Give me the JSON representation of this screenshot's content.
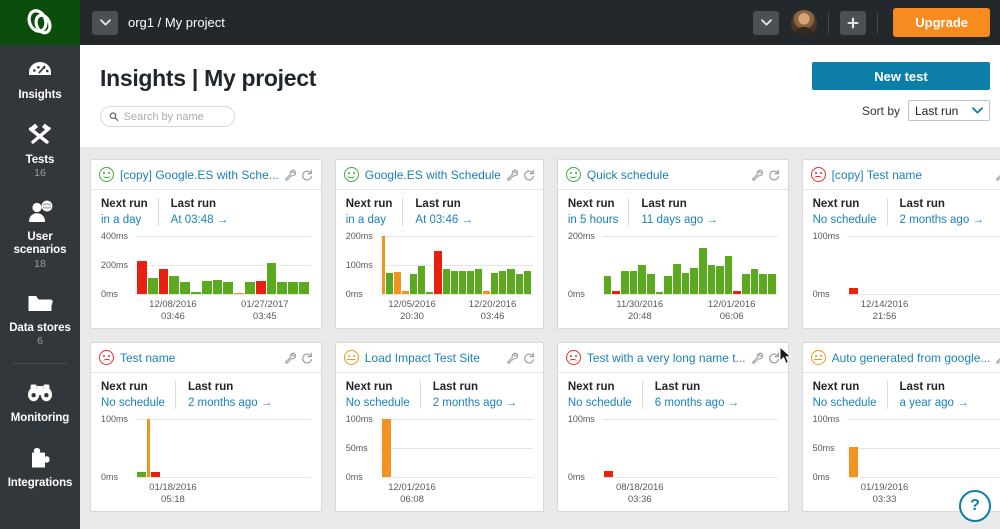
{
  "topbar": {
    "project_toggle_icon": "chevron-down-icon",
    "breadcrumb": "org1 / My project",
    "user_menu_icon": "chevron-down-icon",
    "add_icon": "plus-icon",
    "upgrade_label": "Upgrade"
  },
  "sidebar": {
    "logo": "loadimpact-logo",
    "items": [
      {
        "label": "Insights",
        "count": "",
        "icon": "gauge-icon",
        "active": true
      },
      {
        "label": "Tests",
        "count": "16",
        "icon": "hammers-icon",
        "active": false
      },
      {
        "label": "User scenarios",
        "count": "18",
        "icon": "user-globe-icon",
        "active": false
      },
      {
        "label": "Data stores",
        "count": "6",
        "icon": "folder-icon",
        "active": false
      },
      {
        "label": "Monitoring",
        "count": "",
        "icon": "binoculars-icon",
        "active": false
      },
      {
        "label": "Integrations",
        "count": "",
        "icon": "puzzle-icon",
        "active": false
      }
    ]
  },
  "page": {
    "title": "Insights | My project",
    "new_test_label": "New test",
    "search_placeholder": "Search by name",
    "search_value": "",
    "search_icon": "search-icon",
    "sort_label": "Sort by",
    "sort_value": "Last run",
    "sort_icon": "chevron-down-icon",
    "help_label": "?"
  },
  "labels": {
    "next_run": "Next run",
    "last_run": "Last run",
    "settings_icon": "wrench-icon",
    "refresh_icon": "refresh-icon"
  },
  "colors": {
    "green": "#5aa91e",
    "red": "#e8200f",
    "orange": "#f0941f",
    "accent": "#0d7ea8",
    "link": "#1a82b8",
    "upgrade": "#f68b1f",
    "sidebar": "#32373c",
    "topbar": "#23282d",
    "logo_bg": "#0b4d0b"
  },
  "cards": [
    {
      "status": "green",
      "title": "[copy] Google.ES with Sche...",
      "next_run": "in a day",
      "last_run": "At 03:48 →",
      "chart_data": {
        "type": "bar",
        "ylabel": "ms",
        "yticks": [
          "400ms",
          "200ms",
          "0ms"
        ],
        "ylim": [
          0,
          400
        ],
        "x_start": "12/08/2016 03:46",
        "x_end": "01/27/2017 03:45",
        "bars": [
          {
            "value": 230,
            "color": "red"
          },
          {
            "value": 110,
            "color": "green"
          },
          {
            "value": 175,
            "color": "red"
          },
          {
            "value": 125,
            "color": "green"
          },
          {
            "value": 85,
            "color": "green"
          },
          {
            "value": 12,
            "color": "green"
          },
          {
            "value": 90,
            "color": "green"
          },
          {
            "value": 95,
            "color": "green"
          },
          {
            "value": 85,
            "color": "green"
          },
          {
            "value": 10,
            "color": "orange"
          },
          {
            "value": 80,
            "color": "green"
          },
          {
            "value": 88,
            "color": "red"
          },
          {
            "value": 215,
            "color": "green"
          },
          {
            "value": 85,
            "color": "green"
          },
          {
            "value": 80,
            "color": "green"
          },
          {
            "value": 82,
            "color": "green"
          }
        ]
      }
    },
    {
      "status": "green",
      "title": "Google.ES with Schedule",
      "next_run": "in a day",
      "last_run": "At 03:46 →",
      "chart_data": {
        "type": "bar",
        "ylabel": "ms",
        "yticks": [
          "200ms",
          "100ms",
          "0ms"
        ],
        "ylim": [
          0,
          200
        ],
        "x_start": "12/05/2016 20:30",
        "x_end": "12/20/2016 03:46",
        "bars": [
          {
            "value": 200,
            "color": "orange",
            "thin": true
          },
          {
            "value": 72,
            "color": "green"
          },
          {
            "value": 75,
            "color": "orange"
          },
          {
            "value": 10,
            "color": "orange"
          },
          {
            "value": 70,
            "color": "green"
          },
          {
            "value": 95,
            "color": "green"
          },
          {
            "value": 8,
            "color": "green"
          },
          {
            "value": 150,
            "color": "red"
          },
          {
            "value": 85,
            "color": "green"
          },
          {
            "value": 78,
            "color": "green"
          },
          {
            "value": 80,
            "color": "green"
          },
          {
            "value": 78,
            "color": "green"
          },
          {
            "value": 85,
            "color": "green"
          },
          {
            "value": 10,
            "color": "orange"
          },
          {
            "value": 72,
            "color": "green"
          },
          {
            "value": 78,
            "color": "green"
          },
          {
            "value": 85,
            "color": "green"
          },
          {
            "value": 70,
            "color": "green"
          },
          {
            "value": 80,
            "color": "green"
          }
        ]
      }
    },
    {
      "status": "green",
      "title": "Quick schedule",
      "next_run": "in 5 hours",
      "last_run": "11 days ago →",
      "chart_data": {
        "type": "bar",
        "ylabel": "ms",
        "yticks": [
          "200ms",
          "0ms"
        ],
        "ylim": [
          0,
          200
        ],
        "x_start": "11/30/2016 20:48",
        "x_end": "12/01/2016 06:06",
        "bars": [
          {
            "value": 62,
            "color": "green"
          },
          {
            "value": 9,
            "color": "red"
          },
          {
            "value": 80,
            "color": "green"
          },
          {
            "value": 78,
            "color": "green"
          },
          {
            "value": 100,
            "color": "green"
          },
          {
            "value": 70,
            "color": "green"
          },
          {
            "value": 8,
            "color": "green"
          },
          {
            "value": 62,
            "color": "green"
          },
          {
            "value": 105,
            "color": "green"
          },
          {
            "value": 72,
            "color": "green"
          },
          {
            "value": 90,
            "color": "green"
          },
          {
            "value": 160,
            "color": "green"
          },
          {
            "value": 100,
            "color": "green"
          },
          {
            "value": 95,
            "color": "green"
          },
          {
            "value": 130,
            "color": "green"
          },
          {
            "value": 9,
            "color": "red"
          },
          {
            "value": 70,
            "color": "green"
          },
          {
            "value": 85,
            "color": "green"
          },
          {
            "value": 68,
            "color": "green"
          },
          {
            "value": 70,
            "color": "green"
          }
        ]
      }
    },
    {
      "status": "red",
      "title": "[copy] Test name",
      "next_run": "No schedule",
      "last_run": "2 months ago →",
      "chart_data": {
        "type": "bar",
        "ylabel": "ms",
        "yticks": [
          "100ms",
          "0ms"
        ],
        "ylim": [
          0,
          100
        ],
        "x_start": "12/14/2016 21:56",
        "x_end": "",
        "bars": [
          {
            "value": 10,
            "color": "red"
          }
        ]
      }
    },
    {
      "status": "red",
      "title": "Test name",
      "next_run": "No schedule",
      "last_run": "2 months ago →",
      "chart_data": {
        "type": "bar",
        "ylabel": "ms",
        "yticks": [
          "100ms",
          "0ms"
        ],
        "ylim": [
          0,
          100
        ],
        "x_start": "01/18/2016 05:18",
        "x_end": "",
        "bars": [
          {
            "value": 8,
            "color": "green"
          },
          {
            "value": 100,
            "color": "orange",
            "thin": true
          },
          {
            "value": 9,
            "color": "red"
          }
        ]
      }
    },
    {
      "status": "orange",
      "title": "Load Impact Test Site",
      "next_run": "No schedule",
      "last_run": "2 months ago →",
      "chart_data": {
        "type": "bar",
        "ylabel": "ms",
        "yticks": [
          "100ms",
          "50ms",
          "0ms"
        ],
        "ylim": [
          0,
          100
        ],
        "x_start": "12/01/2016 06:08",
        "x_end": "",
        "bars": [
          {
            "value": 100,
            "color": "orange"
          }
        ]
      }
    },
    {
      "status": "red",
      "title": "Test with a very long name t...",
      "next_run": "No schedule",
      "last_run": "6 months ago →",
      "chart_data": {
        "type": "bar",
        "ylabel": "ms",
        "yticks": [
          "100ms",
          "0ms"
        ],
        "ylim": [
          0,
          100
        ],
        "x_start": "08/18/2016 03:36",
        "x_end": "",
        "bars": [
          {
            "value": 10,
            "color": "red"
          }
        ]
      }
    },
    {
      "status": "orange",
      "title": "Auto generated from google...",
      "next_run": "No schedule",
      "last_run": "a year ago →",
      "chart_data": {
        "type": "bar",
        "ylabel": "ms",
        "yticks": [
          "100ms",
          "50ms",
          "0ms"
        ],
        "ylim": [
          0,
          100
        ],
        "x_start": "01/19/2016 03:33",
        "x_end": "",
        "bars": [
          {
            "value": 52,
            "color": "orange"
          }
        ]
      }
    }
  ]
}
